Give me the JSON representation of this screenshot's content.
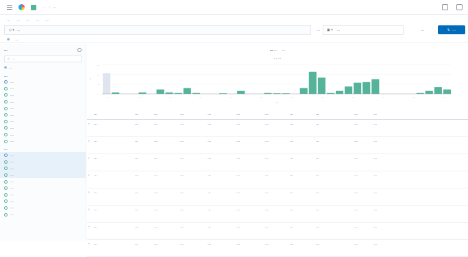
{
  "header": {
    "crumbs": [
      "…",
      "…"
    ]
  },
  "menu": [
    "…",
    "…",
    "…",
    "…",
    "…"
  ],
  "query": {
    "placeholder": "…",
    "lang": "…",
    "date": "…",
    "show_dates": "…",
    "refresh_label": "…"
  },
  "filters": {
    "add_filter": "…"
  },
  "sidebar": {
    "index_pattern": "…",
    "search_placeholder": "…",
    "toggle": "…",
    "selected_title": "…",
    "available_title": "…",
    "selected_fields": [
      "…",
      "…",
      "…",
      "…",
      "…",
      "…",
      "…",
      "…",
      "…",
      "…"
    ],
    "available_fields": [
      "…",
      "…",
      "…",
      "…",
      "…",
      "…",
      "…",
      "…",
      "…",
      "…"
    ]
  },
  "hits": {
    "count": "…",
    "label": "…",
    "reset": "…"
  },
  "range": {
    "text": "…",
    "interval": "…"
  },
  "chart_data": {
    "type": "bar",
    "title": "",
    "xlabel": "…",
    "ylabel": "…",
    "x_ticks": [
      "…",
      "…",
      "…",
      "…",
      "…",
      "…",
      "…",
      "…",
      "…",
      "…",
      "…",
      "…"
    ],
    "y_ticks": [
      "…",
      "…",
      "…",
      "…"
    ],
    "ylim": [
      0,
      1
    ],
    "values": [
      0.7,
      0.05,
      0,
      0,
      0.05,
      0,
      0.15,
      0.05,
      0.03,
      0.2,
      0.03,
      0,
      0,
      0.02,
      0,
      0.1,
      0,
      0,
      0.03,
      0.02,
      0.02,
      0,
      0.2,
      0.75,
      0.55,
      0.03,
      0.1,
      0.25,
      0.38,
      0.4,
      0.5,
      0,
      0,
      0,
      0,
      0.03,
      0.1,
      0.23,
      0.15
    ],
    "highlight_index": 0,
    "colors": {
      "bar": "#54b399",
      "highlight": "#dfe5ef",
      "grid": "#eef0f3",
      "axis": "#98a2b3"
    }
  },
  "table": {
    "columns": [
      "…",
      "…",
      "…",
      "…",
      "…",
      "…",
      "…",
      "…",
      "…",
      "…",
      "…"
    ],
    "rows": [
      [
        "…",
        "…",
        "…",
        "…",
        "…",
        "…",
        "…",
        "…",
        "…",
        "…",
        "…"
      ],
      [
        "…",
        "…",
        "…",
        "…",
        "…",
        "…",
        "…",
        "…",
        "…",
        "…",
        "…"
      ],
      [
        "…",
        "…",
        "…",
        "…",
        "…",
        "…",
        "…",
        "…",
        "…",
        "…",
        "…"
      ],
      [
        "…",
        "…",
        "…",
        "…",
        "…",
        "…",
        "…",
        "…",
        "…",
        "…",
        "…"
      ],
      [
        "…",
        "…",
        "…",
        "…",
        "…",
        "…",
        "…",
        "…",
        "…",
        "…",
        "…"
      ],
      [
        "…",
        "…",
        "…",
        "…",
        "…",
        "…",
        "…",
        "…",
        "…",
        "…",
        "…"
      ],
      [
        "…",
        "…",
        "…",
        "…",
        "…",
        "…",
        "…",
        "…",
        "…",
        "…",
        "…"
      ],
      [
        "…",
        "…",
        "…",
        "…",
        "…",
        "…",
        "…",
        "…",
        "…",
        "…",
        "…"
      ]
    ]
  }
}
